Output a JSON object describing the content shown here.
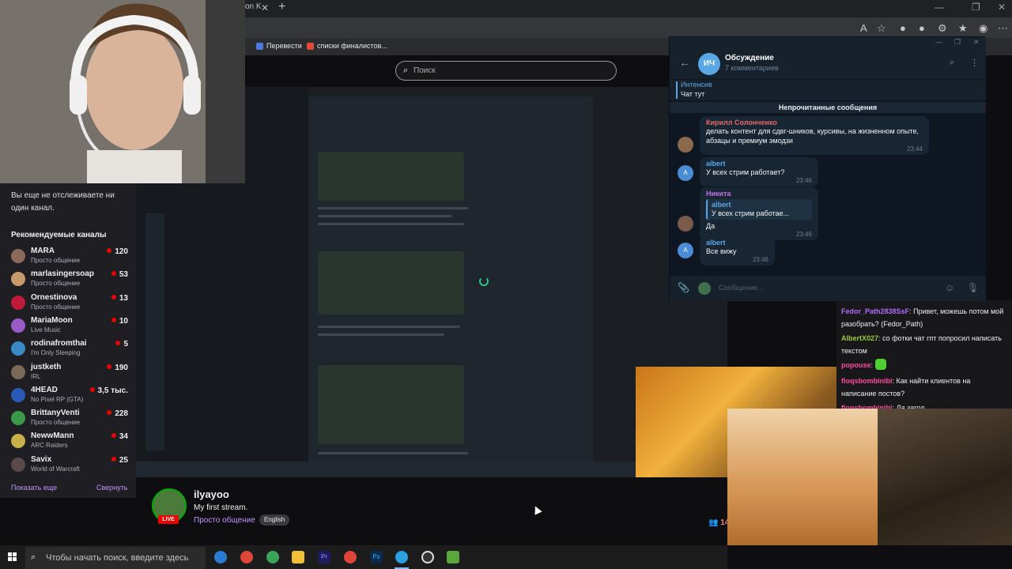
{
  "browser": {
    "tab_fragment": "on K",
    "bookmarks": [
      {
        "label": "Перевести"
      },
      {
        "label": "списки финалистов..."
      }
    ]
  },
  "twitch": {
    "search_placeholder": "Поиск",
    "sidebar": {
      "not_following_note": "Вы еще не отслеживаете ни один канал.",
      "recommended_heading": "Рекомендуемые каналы",
      "show_more": "Показать еще",
      "collapse": "Свернуть",
      "channels": [
        {
          "name": "MARA",
          "category": "Просто общение",
          "viewers": "120",
          "avatar_color": "#8a6a5a"
        },
        {
          "name": "marlasingersoap",
          "category": "Просто общение",
          "viewers": "53",
          "avatar_color": "#c89a6a"
        },
        {
          "name": "Ornestinova",
          "category": "Просто общение",
          "viewers": "13",
          "avatar_color": "#c01a3a"
        },
        {
          "name": "MariaMoon",
          "category": "Live Music",
          "viewers": "10",
          "avatar_color": "#9a5ac8"
        },
        {
          "name": "rodinafromthai",
          "category": "I'm Only Sleeping",
          "viewers": "5",
          "avatar_color": "#3a8ac8"
        },
        {
          "name": "justketh",
          "category": "IRL",
          "viewers": "190",
          "avatar_color": "#7a6a5a"
        },
        {
          "name": "4HEAD",
          "category": "No Pixel RP (GTA)",
          "viewers": "3,5 тыс.",
          "avatar_color": "#2a5ab8"
        },
        {
          "name": "BrittanyVenti",
          "category": "Просто общение",
          "viewers": "228",
          "avatar_color": "#3a9a4a"
        },
        {
          "name": "NewwMann",
          "category": "ARC Raiders",
          "viewers": "34",
          "avatar_color": "#c8b04a"
        },
        {
          "name": "Savix",
          "category": "World of Warcraft",
          "viewers": "25",
          "avatar_color": "#5a4a4a"
        }
      ]
    },
    "stream": {
      "streamer": "ilyayoo",
      "live_label": "LIVE",
      "title": "My first stream.",
      "category": "Просто общение",
      "tag": "English",
      "viewers": "14"
    },
    "chat": [
      {
        "user": "Fedor_Path2838SsF",
        "color": "#b36bff",
        "text": "Привет, можешь потом мой разобрать? (Fedor_Path)"
      },
      {
        "user": "AlbertX027",
        "color": "#9acd32",
        "text": "со фотки чат гпт попросил написать текстом"
      },
      {
        "user": "popouse",
        "color": "#ff4aa0",
        "text": "",
        "emote": true
      },
      {
        "user": "floqsbombinibi",
        "color": "#ff4aa0",
        "text": "Как найти клиентов на написание постов?"
      },
      {
        "user": "floqsbombinibi",
        "color": "#ff4aa0",
        "text": "Да загод"
      }
    ]
  },
  "telegram": {
    "avatar_initials": "ИЧ",
    "title": "Обсуждение",
    "subtitle": "7 комментариев",
    "pinned_title": "Интенсив",
    "pinned_text": "Чат тут",
    "unread_label": "Непрочитанные сообщения",
    "input_placeholder": "Сообщение...",
    "messages": [
      {
        "author": "Кирилл Солонченко",
        "author_color": "#e56a6a",
        "avatar": "",
        "avatar_color": "#8a6a4a",
        "text": "делать контент для сдвг-шников, курсивы, на жизненном опыте, абзацы и премиум эмодзи",
        "time": "23:44"
      },
      {
        "author": "albert",
        "author_color": "#5aa7e6",
        "avatar": "A",
        "avatar_color": "#4a8cd6",
        "text": "У всех стрим работает?",
        "time": "23:46"
      },
      {
        "author": "Никита",
        "author_color": "#c071e8",
        "avatar": "",
        "avatar_color": "#7a5a4a",
        "quote_author": "albert",
        "quote_text": "У всех стрим работае...",
        "text": "Да",
        "time": "23:46"
      },
      {
        "author": "albert",
        "author_color": "#5aa7e6",
        "avatar": "A",
        "avatar_color": "#4a8cd6",
        "text": "Все вижу",
        "time": "23:46"
      }
    ]
  },
  "taskbar": {
    "search_placeholder": "Чтобы начать поиск, введите здесь"
  }
}
